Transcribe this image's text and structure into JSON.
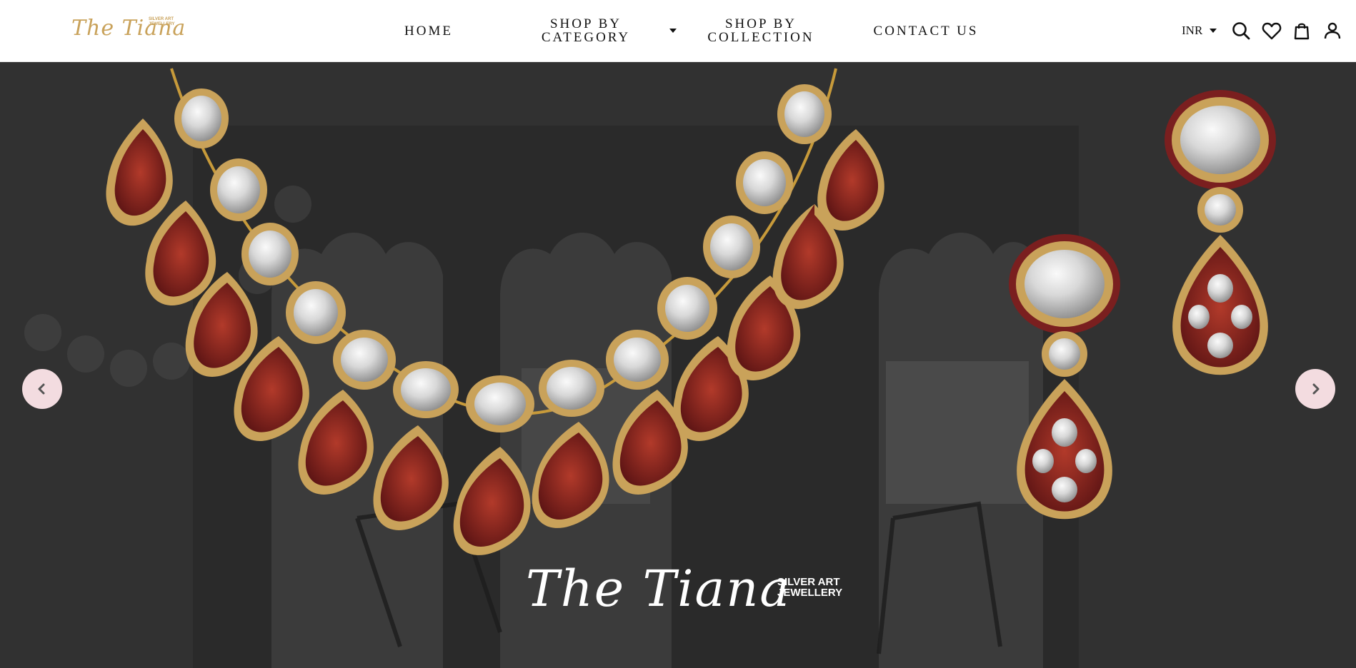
{
  "logo": {
    "script": "The Tiana",
    "tag_line1": "SILVER ART",
    "tag_line2": "JEWELLERY"
  },
  "nav": {
    "home": "HOME",
    "category": "SHOP BY CATEGORY",
    "collection": "SHOP BY COLLECTION",
    "contact": "CONTACT US"
  },
  "currency": {
    "selected": "INR"
  },
  "icons": [
    "search-icon",
    "heart-icon",
    "bag-icon",
    "user-icon",
    "chevron-left-icon",
    "chevron-right-icon"
  ],
  "hero": {
    "brand_script": "The Tiana",
    "brand_tag_line1": "SILVER ART",
    "brand_tag_line2": "JEWELLERY"
  },
  "colors": {
    "gold": "#c9a25a",
    "maroon": "#7a1f1f",
    "hero_bg": "#323232",
    "arrow_bg": "#f3dce0"
  }
}
